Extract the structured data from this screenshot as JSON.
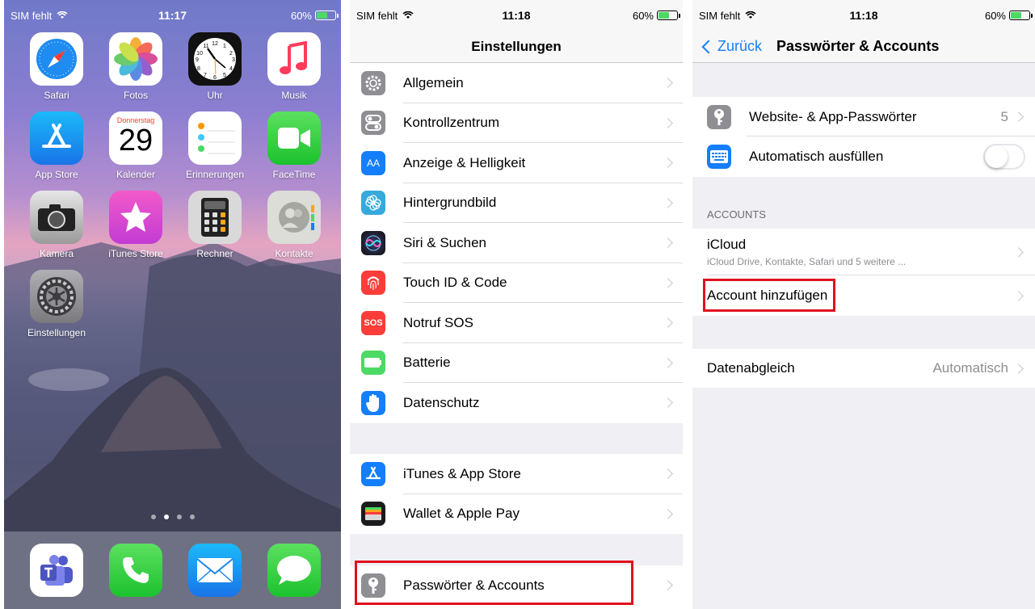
{
  "home": {
    "status": {
      "carrier": "SIM fehlt",
      "time": "11:17",
      "battery": "60%"
    },
    "apps": [
      {
        "label": "Safari",
        "icon": "safari-icon"
      },
      {
        "label": "Fotos",
        "icon": "photos-icon"
      },
      {
        "label": "Uhr",
        "icon": "clock-icon"
      },
      {
        "label": "Musik",
        "icon": "music-icon"
      },
      {
        "label": "App Store",
        "icon": "app-store-icon"
      },
      {
        "label": "Kalender",
        "icon": "calendar-icon"
      },
      {
        "label": "Erinnerungen",
        "icon": "reminders-icon"
      },
      {
        "label": "FaceTime",
        "icon": "facetime-icon"
      },
      {
        "label": "Kamera",
        "icon": "camera-icon"
      },
      {
        "label": "iTunes Store",
        "icon": "itunes-store-icon"
      },
      {
        "label": "Rechner",
        "icon": "calculator-icon"
      },
      {
        "label": "Kontakte",
        "icon": "contacts-icon"
      },
      {
        "label": "Einstellungen",
        "icon": "settings-icon"
      }
    ],
    "calendar_day": "Donnerstag",
    "calendar_date": "29",
    "clock_numbers": {
      "n10": "10",
      "n11": "11",
      "n12": "12",
      "n1": "1",
      "n2": "2",
      "n3": "3",
      "n4": "4",
      "n5": "5",
      "n6": "6",
      "n7": "7",
      "n8": "8",
      "n9": "9"
    },
    "dock_apps": [
      "teams-icon",
      "phone-icon",
      "mail-icon",
      "messages-icon"
    ],
    "page_dots": 4,
    "active_page": 1
  },
  "settings": {
    "status": {
      "carrier": "SIM fehlt",
      "time": "11:18",
      "battery": "60%"
    },
    "title": "Einstellungen",
    "group1": [
      {
        "label": "Allgemein",
        "icon": "gear-icon",
        "color": "#8e8e93"
      },
      {
        "label": "Kontrollzentrum",
        "icon": "control-center-icon",
        "color": "#8e8e93"
      },
      {
        "label": "Anzeige & Helligkeit",
        "icon": "display-brightness-icon",
        "color": "#147efb",
        "icon_text": "AA"
      },
      {
        "label": "Hintergrundbild",
        "icon": "wallpaper-icon",
        "color": "#36aadc"
      },
      {
        "label": "Siri & Suchen",
        "icon": "siri-icon",
        "color": "#1d1d2f"
      },
      {
        "label": "Touch ID & Code",
        "icon": "fingerprint-icon",
        "color": "#fc3d39"
      },
      {
        "label": "Notruf SOS",
        "icon": "sos-icon",
        "color": "#fc3d39",
        "icon_text": "SOS"
      },
      {
        "label": "Batterie",
        "icon": "battery-icon",
        "color": "#4cd964"
      },
      {
        "label": "Datenschutz",
        "icon": "privacy-hand-icon",
        "color": "#147efb"
      }
    ],
    "group2": [
      {
        "label": "iTunes & App Store",
        "icon": "app-store-icon",
        "color": "#147efb"
      },
      {
        "label": "Wallet & Apple Pay",
        "icon": "wallet-icon",
        "color": "#1c1c1e"
      }
    ],
    "group3": [
      {
        "label": "Passwörter & Accounts",
        "icon": "key-icon",
        "color": "#8e8e93"
      }
    ],
    "highlight_color": "#e0101e"
  },
  "accounts": {
    "status": {
      "carrier": "SIM fehlt",
      "time": "11:18",
      "battery": "60%"
    },
    "back_label": "Zurück",
    "title": "Passwörter & Accounts",
    "website_passwords": {
      "label": "Website- & App-Passwörter",
      "count": "5"
    },
    "autofill": {
      "label": "Automatisch ausfüllen",
      "enabled": false
    },
    "section_accounts": "ACCOUNTS",
    "icloud": {
      "label": "iCloud",
      "subtitle": "iCloud Drive, Kontakte, Safari und 5 weitere ..."
    },
    "add_account": "Account hinzufügen",
    "fetch": {
      "label": "Datenabgleich",
      "value": "Automatisch"
    },
    "accent": "#147efb"
  }
}
